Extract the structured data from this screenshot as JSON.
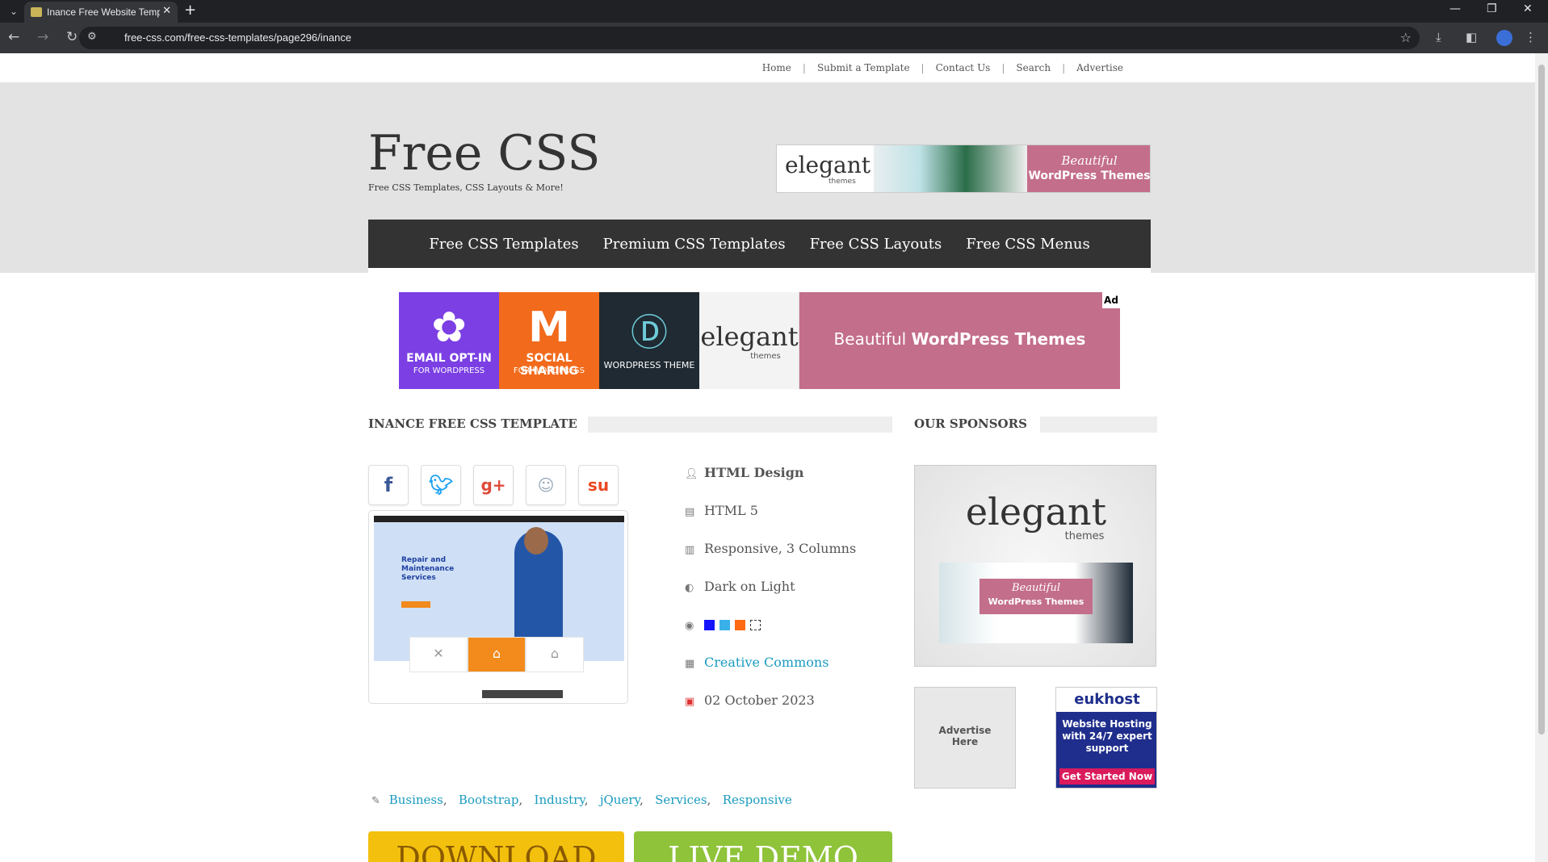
{
  "browser": {
    "tab_title": "Inance Free Website Template |",
    "url": "free-css.com/free-css-templates/page296/inance"
  },
  "topnav": {
    "links": [
      "Home",
      "Submit a Template",
      "Contact Us",
      "Search",
      "Advertise"
    ]
  },
  "site": {
    "title": "Free CSS",
    "tagline": "Free CSS Templates, CSS Layouts & More!"
  },
  "top_ad": {
    "logo": "elegant",
    "logo_sub": "themes",
    "line1": "Beautiful",
    "line2": "WordPress Themes"
  },
  "main_nav": [
    "Free CSS Templates",
    "Premium CSS Templates",
    "Free CSS Layouts",
    "Free CSS Menus"
  ],
  "banner_ad": {
    "cell1_l1": "EMAIL OPT-IN",
    "cell1_l2": "FOR WORDPRESS",
    "cell2_l1": "SOCIAL SHARING",
    "cell2_l2": "FOR WORDPRESS",
    "cell3_l2": "WORDPRESS THEME",
    "cell4_logo": "elegant",
    "cell4_sub": "themes",
    "text_light": "Beautiful",
    "text_bold": "WordPress Themes",
    "badge": "Ad"
  },
  "template": {
    "heading": "INANCE FREE CSS TEMPLATE",
    "thumb_headline": "Repair and Maintenance Services",
    "meta": {
      "design": "HTML Design",
      "html": "HTML 5",
      "layout": "Responsive, 3 Columns",
      "scheme": "Dark on Light",
      "license": "Creative Commons",
      "date": "02 October 2023"
    },
    "colors": [
      "#1414ff",
      "#3ab0e8",
      "#ff6a13"
    ],
    "tags": [
      "Business",
      "Bootstrap",
      "Industry",
      "jQuery",
      "Services",
      "Responsive"
    ],
    "download_label": "DOWNLOAD",
    "demo_label": "LIVE DEMO"
  },
  "sponsors": {
    "heading": "OUR SPONSORS",
    "big_logo": "elegant",
    "big_sub": "themes",
    "big_r1": "Beautiful",
    "big_r2": "WordPress Themes",
    "advertise_l1": "Advertise",
    "advertise_l2": "Here",
    "euk_brand": "eukhost",
    "euk_text": "Website Hosting with 24/7 expert support",
    "euk_cta": "Get Started Now"
  }
}
